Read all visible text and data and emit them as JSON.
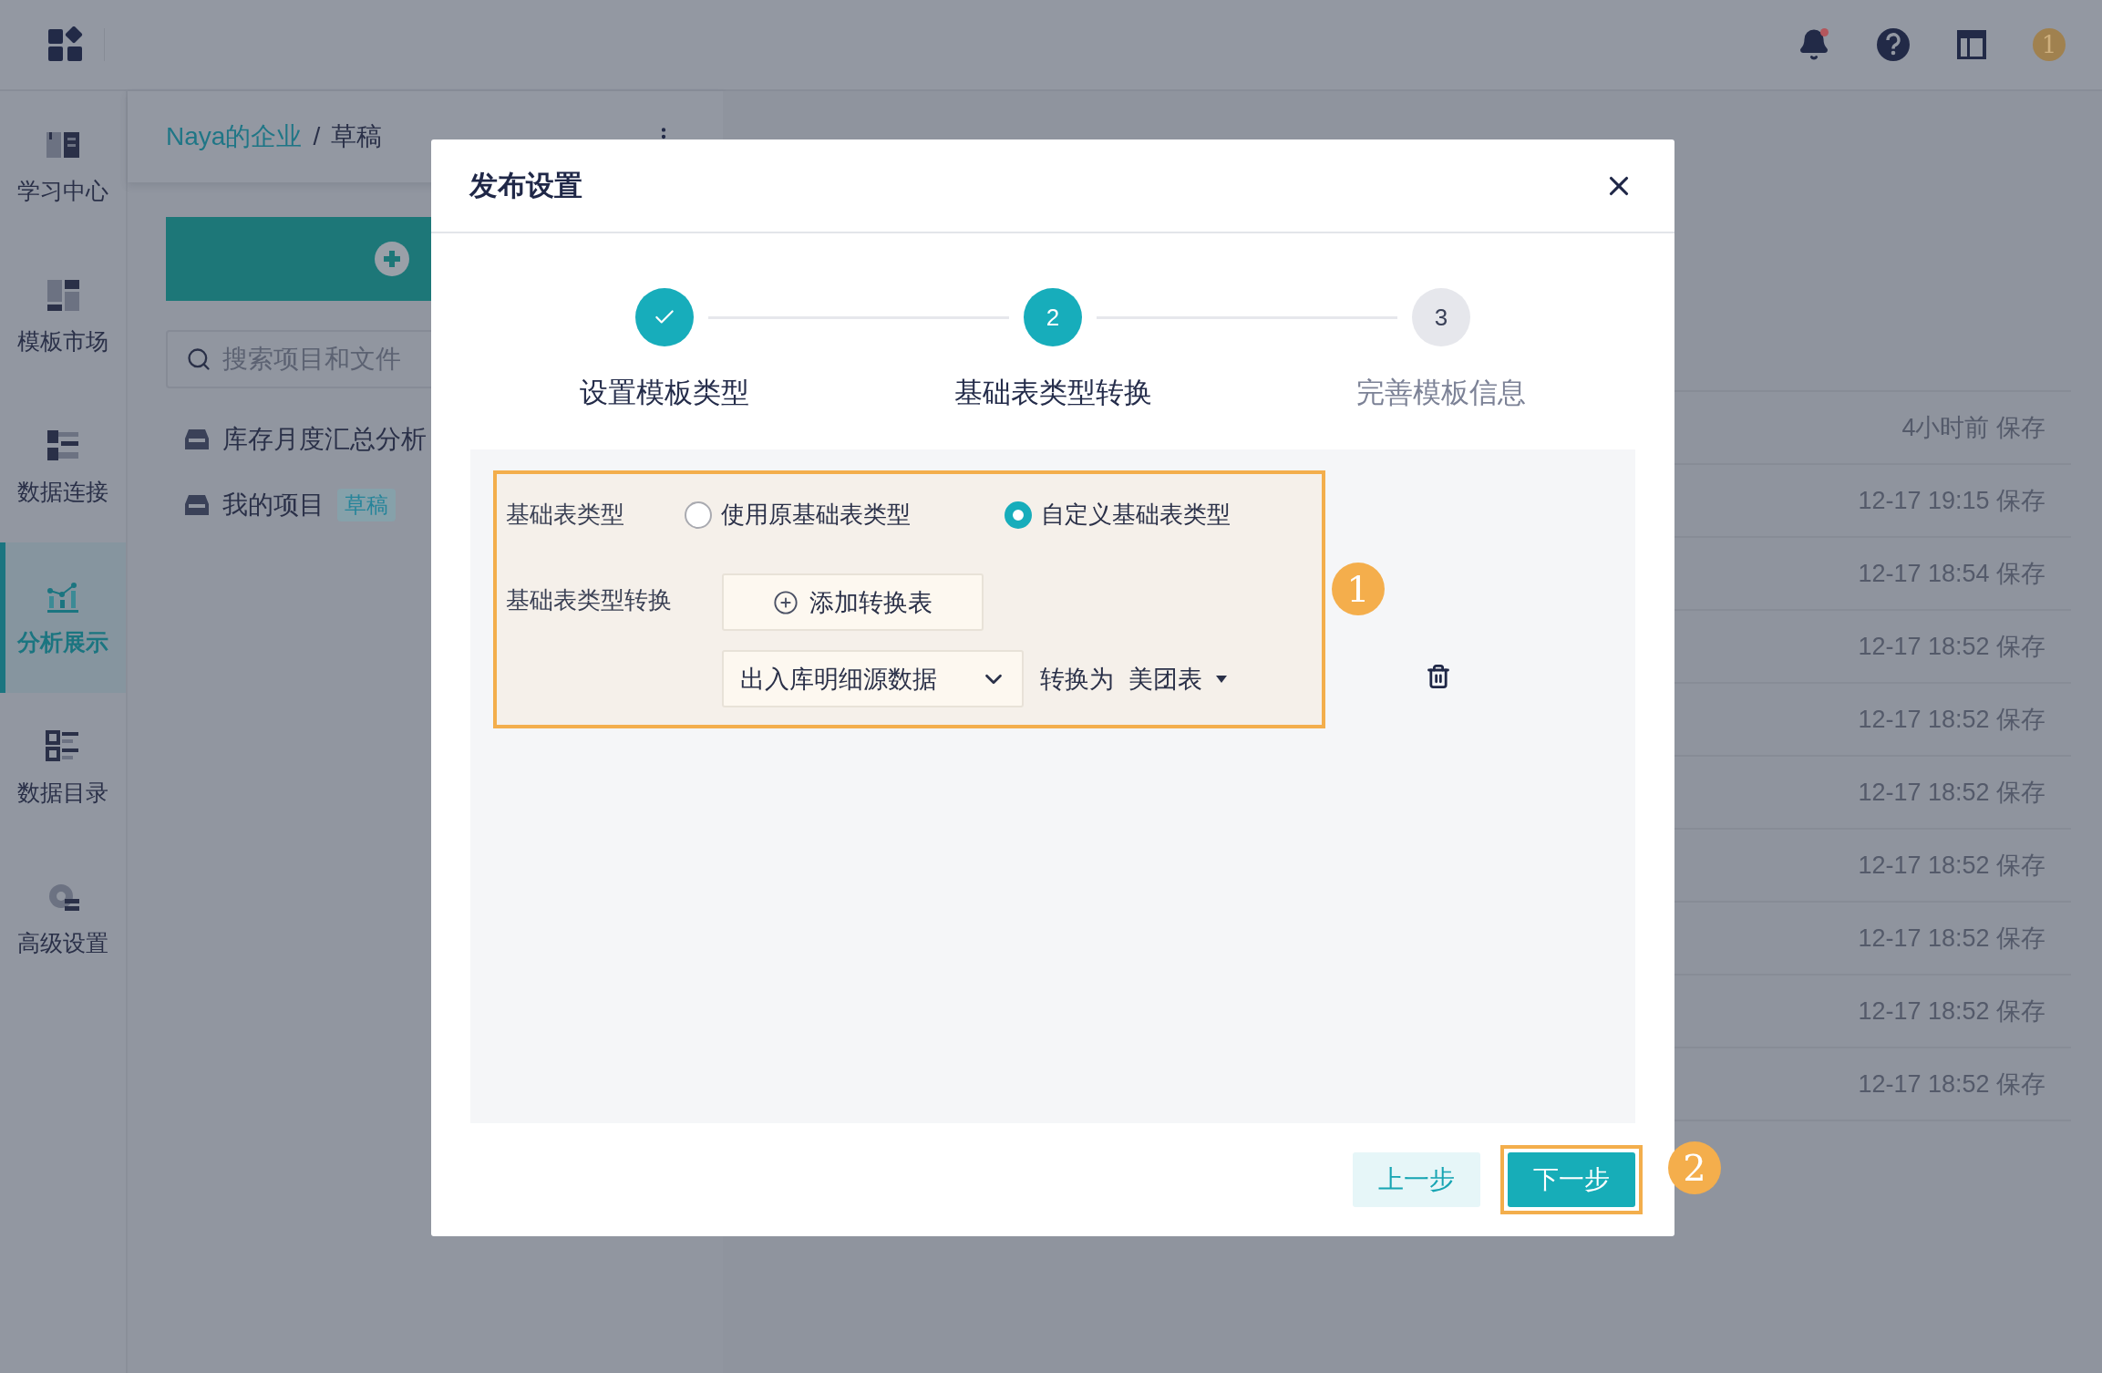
{
  "top_bar": {
    "user_badge": "1"
  },
  "sidebar": {
    "items": [
      {
        "label": "学习中心",
        "kind": "book",
        "selected": false
      },
      {
        "label": "模板市场",
        "kind": "template",
        "selected": false
      },
      {
        "label": "数据连接",
        "kind": "connect",
        "selected": false
      },
      {
        "label": "分析展示",
        "kind": "chart",
        "selected": true
      },
      {
        "label": "数据目录",
        "kind": "catalog",
        "selected": false
      },
      {
        "label": "高级设置",
        "kind": "settings",
        "selected": false
      }
    ]
  },
  "left_panel": {
    "breadcrumb": {
      "parent": "Naya的企业",
      "separator": "/",
      "current": "草稿"
    },
    "search": {
      "placeholder": "搜索项目和文件"
    },
    "tree": [
      {
        "label": "库存月度汇总分析"
      },
      {
        "label": "我的项目",
        "tag": "草稿"
      }
    ]
  },
  "recent_list": {
    "rows": [
      {
        "time": "4小时前 保存"
      },
      {
        "time": "12-17 19:15 保存"
      },
      {
        "time": "12-17 18:54 保存"
      },
      {
        "time": "12-17 18:52 保存"
      },
      {
        "time": "12-17 18:52 保存"
      },
      {
        "time": "12-17 18:52 保存"
      },
      {
        "time": "12-17 18:52 保存"
      },
      {
        "time": "12-17 18:52 保存"
      },
      {
        "time": "12-17 18:52 保存"
      },
      {
        "time": "12-17 18:52 保存"
      }
    ]
  },
  "dialog": {
    "title": "发布设置",
    "steps": [
      {
        "label": "设置模板类型",
        "kind": "done"
      },
      {
        "number": "2",
        "label": "基础表类型转换",
        "kind": "current"
      },
      {
        "number": "3",
        "label": "完善模板信息",
        "kind": "pending"
      }
    ],
    "form": {
      "highlighted": true,
      "type_label": "基础表类型",
      "type_options": [
        {
          "label": "使用原基础表类型",
          "selected": false
        },
        {
          "label": "自定义基础表类型",
          "selected": true
        }
      ],
      "conversion_label": "基础表类型转换",
      "add_button": "添加转换表",
      "mappings": [
        {
          "source": "出入库明细源数据",
          "link_text": "转换为",
          "target": "美团表"
        }
      ]
    },
    "form_marker": "1",
    "buttons": [
      {
        "label": "上一步",
        "kind": "secondary",
        "highlighted": false
      },
      {
        "label": "下一步",
        "kind": "primary",
        "highlighted": true
      }
    ],
    "button_marker": "2"
  }
}
